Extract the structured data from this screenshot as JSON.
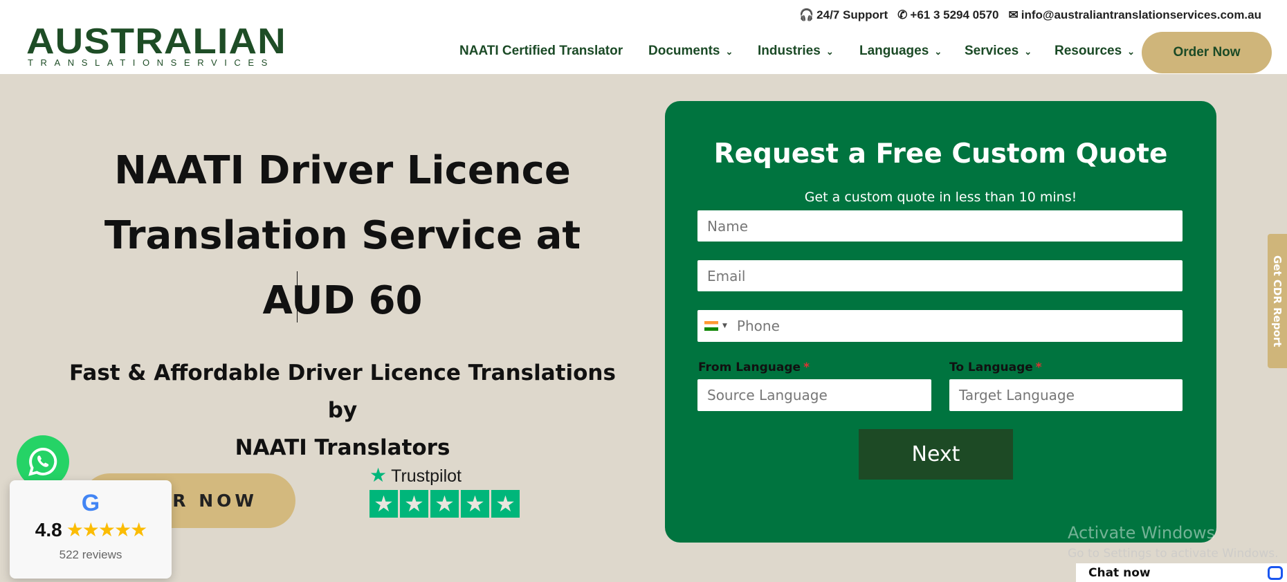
{
  "header": {
    "logo_main": "AUSTRALIAN",
    "logo_sub": "TRANSLATIONSERVICES",
    "topbar": {
      "support": "24/7 Support",
      "phone": "+61 3 5294 0570",
      "email": "info@australiantranslationservices.com.au"
    },
    "nav": [
      {
        "label": "NAATI Certified Translator",
        "dropdown": false
      },
      {
        "label": "Documents",
        "dropdown": true
      },
      {
        "label": "Industries",
        "dropdown": true
      },
      {
        "label": "Languages",
        "dropdown": true
      },
      {
        "label": "Services",
        "dropdown": true
      },
      {
        "label": "Resources",
        "dropdown": true
      }
    ],
    "order_button": "Order Now"
  },
  "hero": {
    "title_lines": [
      "NAATI Driver Licence",
      "Translation Service at",
      "AUD 60"
    ],
    "subtitle_lines": [
      "Fast & Affordable Driver Licence Translations by",
      "NAATI Translators"
    ],
    "order_button": "ORDER NOW",
    "trustpilot_label": "Trustpilot",
    "trustpilot_stars": 5
  },
  "google_card": {
    "rating": "4.8",
    "stars": 5,
    "reviews": "522 reviews"
  },
  "form": {
    "title": "Request a Free Custom Quote",
    "subtitle": "Get a custom quote in less than 10 mins!",
    "name_placeholder": "Name",
    "email_placeholder": "Email",
    "phone_placeholder": "Phone",
    "from_label": "From Language",
    "to_label": "To Language",
    "required_mark": "*",
    "from_placeholder": "Source Language",
    "to_placeholder": "Target Language",
    "next_button": "Next"
  },
  "side_tab": "Get CDR Report",
  "os_watermark": {
    "line1": "Activate Windows",
    "line2": "Go to Settings to activate Windows."
  },
  "chat_widget": "Chat now",
  "colors": {
    "brand_green": "#00743f",
    "dark_green": "#1d4a25",
    "gold": "#cfb57a",
    "background": "#ded8cc",
    "trustpilot": "#00b67a"
  }
}
